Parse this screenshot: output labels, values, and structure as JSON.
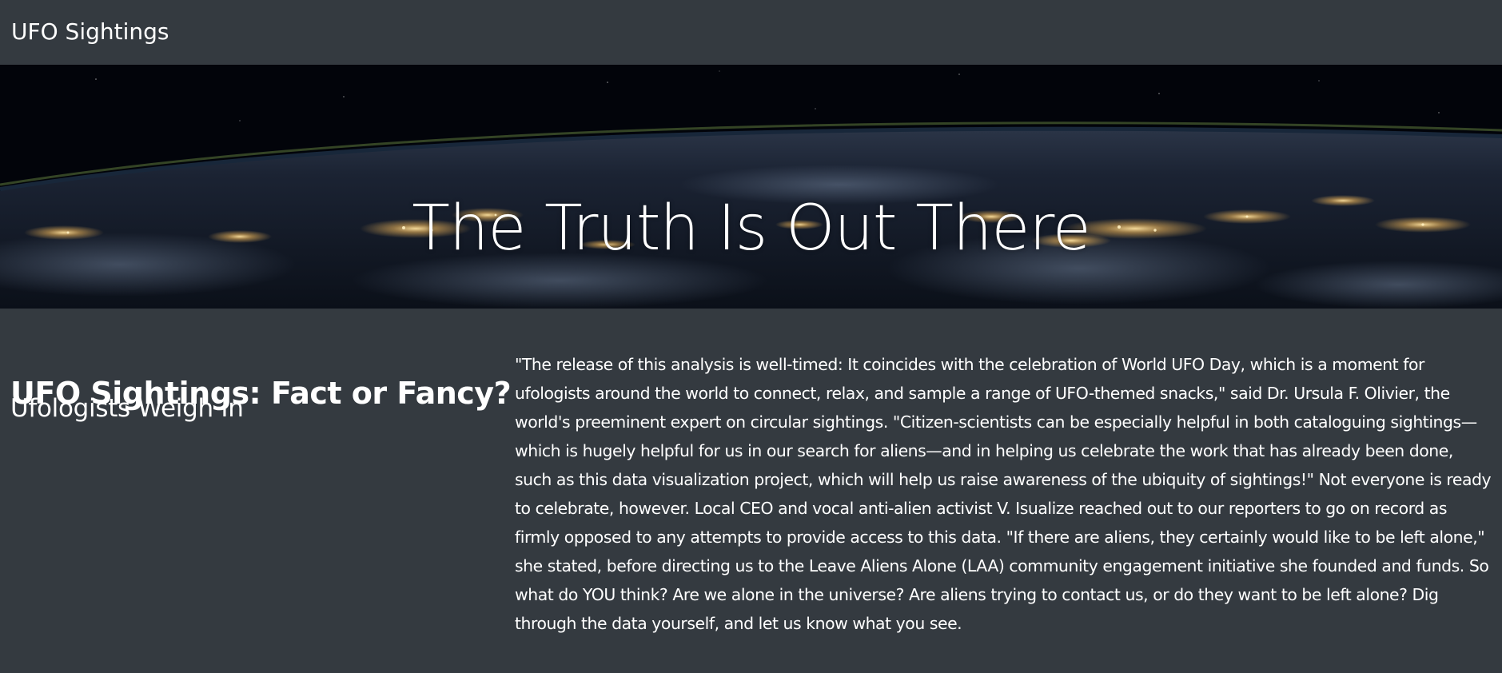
{
  "navbar": {
    "brand": "UFO Sightings"
  },
  "hero": {
    "title": "The Truth Is Out There"
  },
  "article": {
    "title": "UFO Sightings: Fact or Fancy?",
    "subtitle": "Ufologists Weigh In",
    "body": "\"The release of this analysis is well-timed: It coincides with the celebration of World UFO Day, which is a moment for ufologists around the world to connect, relax, and sample a range of UFO-themed snacks,\" said Dr. Ursula F. Olivier, the world's preeminent expert on circular sightings. \"Citizen-scientists can be especially helpful in both cataloguing sightings—which is hugely helpful for us in our search for aliens—and in helping us celebrate the work that has already been done, such as this data visualization project, which will help us raise awareness of the ubiquity of sightings!\" Not everyone is ready to celebrate, however. Local CEO and vocal anti-alien activist V. Isualize reached out to our reporters to go on record as firmly opposed to any attempts to provide access to this data. \"If there are aliens, they certainly would like to be left alone,\" she stated, before directing us to the Leave Aliens Alone (LAA) community engagement initiative she founded and funds. So what do YOU think? Are we alone in the universe? Are aliens trying to contact us, or do they want to be left alone? Dig through the data yourself, and let us know what you see."
  },
  "colors": {
    "background": "#343a40",
    "text": "#ffffff",
    "hero_sky": "#02040a",
    "city_lights": "#ffd27a"
  }
}
